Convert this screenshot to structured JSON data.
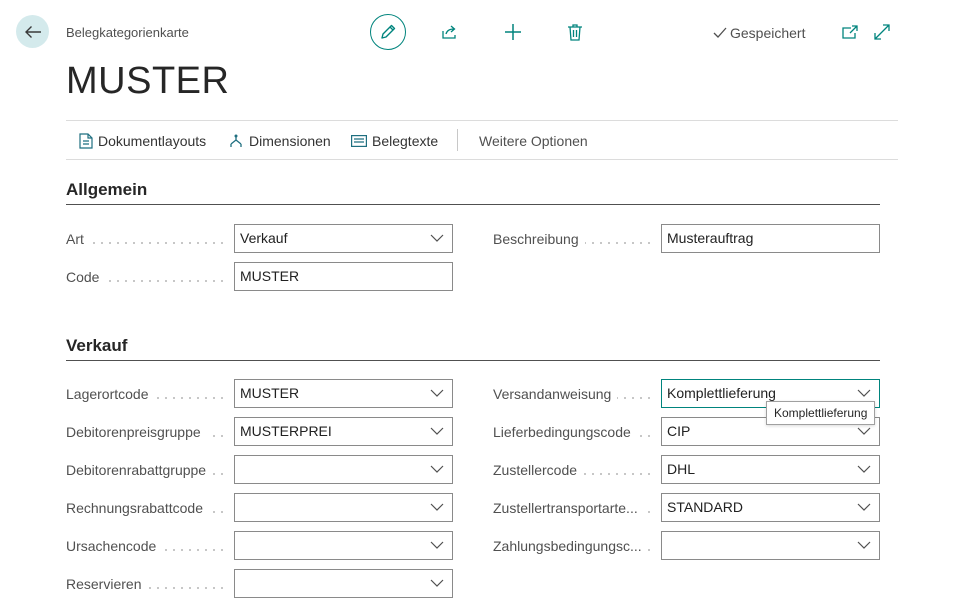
{
  "header": {
    "page_type": "Belegkategorienkarte",
    "title": "MUSTER",
    "saved_status": "Gespeichert"
  },
  "actions": {
    "items": [
      {
        "label": "Dokumentlayouts",
        "icon": "document-layouts-icon"
      },
      {
        "label": "Dimensionen",
        "icon": "dimensions-icon"
      },
      {
        "label": "Belegtexte",
        "icon": "document-texts-icon"
      }
    ],
    "more": "Weitere Optionen"
  },
  "sections": {
    "general": {
      "title": "Allgemein",
      "art_label": "Art",
      "art_value": "Verkauf",
      "code_label": "Code",
      "code_value": "MUSTER",
      "beschreibung_label": "Beschreibung",
      "beschreibung_value": "Musterauftrag"
    },
    "sales": {
      "title": "Verkauf",
      "left": [
        {
          "label": "Lagerortcode",
          "value": "MUSTER"
        },
        {
          "label": "Debitorenpreisgruppe",
          "value": "MUSTERPREI"
        },
        {
          "label": "Debitorenrabattgruppe",
          "value": ""
        },
        {
          "label": "Rechnungsrabattcode",
          "value": ""
        },
        {
          "label": "Ursachencode",
          "value": ""
        },
        {
          "label": "Reservieren",
          "value": ""
        }
      ],
      "right": [
        {
          "label": "Versandanweisung",
          "value": "Komplettlieferung"
        },
        {
          "label": "Lieferbedingungscode",
          "value": "CIP"
        },
        {
          "label": "Zustellercode",
          "value": "DHL"
        },
        {
          "label": "Zustellertransportarte...",
          "value": "STANDARD"
        },
        {
          "label": "Zahlungsbedingungsc...",
          "value": ""
        }
      ]
    }
  },
  "tooltip": {
    "text": "Komplettlieferung"
  },
  "colors": {
    "accent": "#00847d",
    "back_button_bg": "#d4eaec"
  }
}
